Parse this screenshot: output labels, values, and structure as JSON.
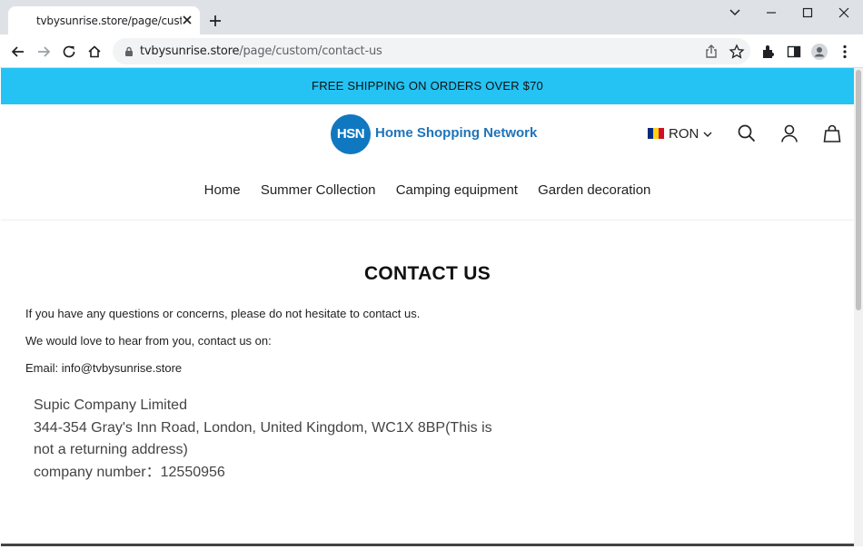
{
  "browser": {
    "tab_title": "tvbysunrise.store/page/custom/c",
    "url_domain": "tvbysunrise.store",
    "url_path": "/page/custom/contact-us"
  },
  "site": {
    "announcement": "FREE SHIPPING ON ORDERS OVER $70",
    "logo_mark": "HSN",
    "logo_text": "Home Shopping Network",
    "currency": "RON",
    "nav": [
      "Home",
      "Summer Collection",
      "Camping equipment",
      "Garden decoration"
    ]
  },
  "content": {
    "title": "CONTACT US",
    "intro": "If you have any questions or concerns, please do not hesitate to contact us.",
    "reach": "We would love to hear from you, contact us on:",
    "email": "Email: info@tvbysunrise.store",
    "address_lines": [
      "Supic Company Limited",
      "344-354 Gray's Inn Road, London, United Kingdom, WC1X 8BP(This is",
      "not a returning address)",
      "company number：12550956"
    ]
  },
  "colors": {
    "announcement_bg": "#24c3f3",
    "brand_blue": "#1078c0"
  }
}
